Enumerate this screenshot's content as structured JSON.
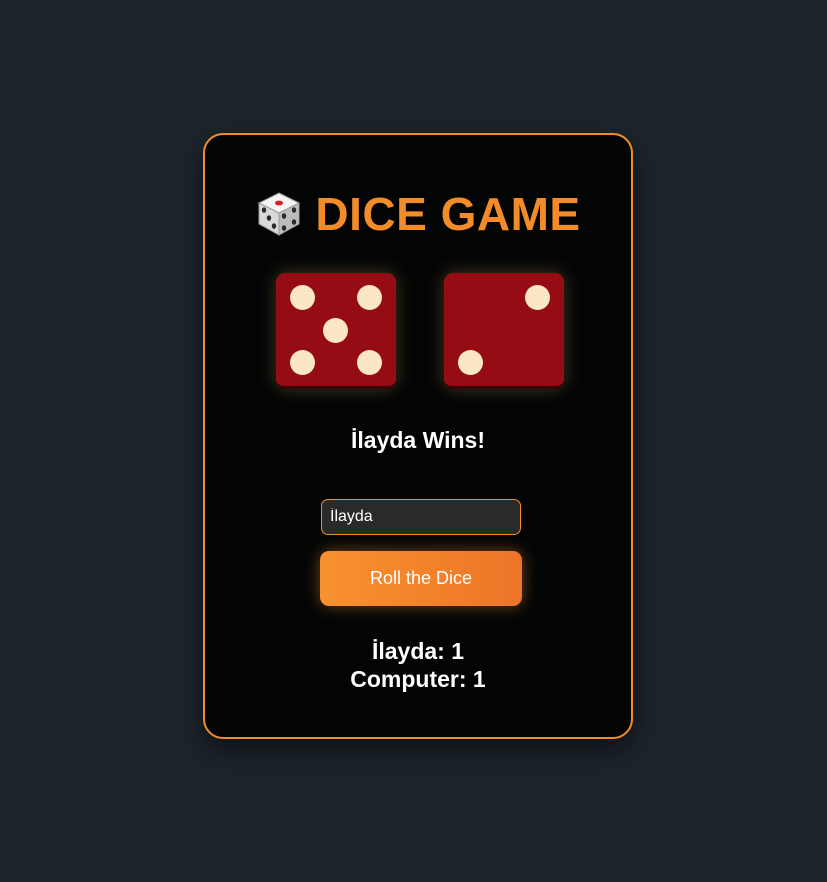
{
  "header": {
    "icon": "dice-icon",
    "title": "DICE GAME"
  },
  "dice": {
    "player_face": 5,
    "computer_face": 2,
    "face_color": "#960c14",
    "pip_color": "#fbe7c6"
  },
  "result": {
    "message": "İlayda Wins!"
  },
  "form": {
    "name_value": "İlayda",
    "roll_label": "Roll the Dice"
  },
  "scores": {
    "player": "İlayda: 1",
    "computer": "Computer: 1"
  },
  "colors": {
    "background": "#1d252c",
    "card": "#030505",
    "accent": "#f28c28"
  }
}
